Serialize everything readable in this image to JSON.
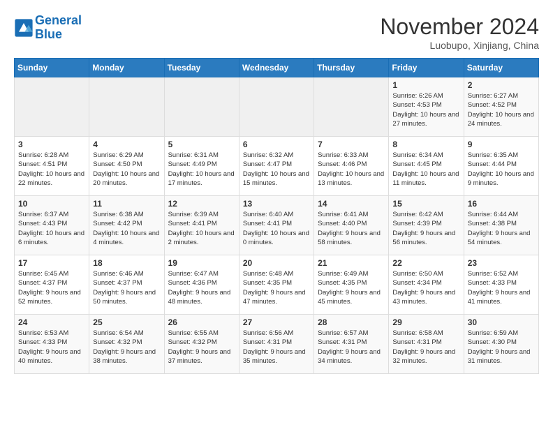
{
  "header": {
    "logo_line1": "General",
    "logo_line2": "Blue",
    "month": "November 2024",
    "location": "Luobupo, Xinjiang, China"
  },
  "days_of_week": [
    "Sunday",
    "Monday",
    "Tuesday",
    "Wednesday",
    "Thursday",
    "Friday",
    "Saturday"
  ],
  "weeks": [
    [
      {
        "day": "",
        "content": ""
      },
      {
        "day": "",
        "content": ""
      },
      {
        "day": "",
        "content": ""
      },
      {
        "day": "",
        "content": ""
      },
      {
        "day": "",
        "content": ""
      },
      {
        "day": "1",
        "content": "Sunrise: 6:26 AM\nSunset: 4:53 PM\nDaylight: 10 hours and 27 minutes."
      },
      {
        "day": "2",
        "content": "Sunrise: 6:27 AM\nSunset: 4:52 PM\nDaylight: 10 hours and 24 minutes."
      }
    ],
    [
      {
        "day": "3",
        "content": "Sunrise: 6:28 AM\nSunset: 4:51 PM\nDaylight: 10 hours and 22 minutes."
      },
      {
        "day": "4",
        "content": "Sunrise: 6:29 AM\nSunset: 4:50 PM\nDaylight: 10 hours and 20 minutes."
      },
      {
        "day": "5",
        "content": "Sunrise: 6:31 AM\nSunset: 4:49 PM\nDaylight: 10 hours and 17 minutes."
      },
      {
        "day": "6",
        "content": "Sunrise: 6:32 AM\nSunset: 4:47 PM\nDaylight: 10 hours and 15 minutes."
      },
      {
        "day": "7",
        "content": "Sunrise: 6:33 AM\nSunset: 4:46 PM\nDaylight: 10 hours and 13 minutes."
      },
      {
        "day": "8",
        "content": "Sunrise: 6:34 AM\nSunset: 4:45 PM\nDaylight: 10 hours and 11 minutes."
      },
      {
        "day": "9",
        "content": "Sunrise: 6:35 AM\nSunset: 4:44 PM\nDaylight: 10 hours and 9 minutes."
      }
    ],
    [
      {
        "day": "10",
        "content": "Sunrise: 6:37 AM\nSunset: 4:43 PM\nDaylight: 10 hours and 6 minutes."
      },
      {
        "day": "11",
        "content": "Sunrise: 6:38 AM\nSunset: 4:42 PM\nDaylight: 10 hours and 4 minutes."
      },
      {
        "day": "12",
        "content": "Sunrise: 6:39 AM\nSunset: 4:41 PM\nDaylight: 10 hours and 2 minutes."
      },
      {
        "day": "13",
        "content": "Sunrise: 6:40 AM\nSunset: 4:41 PM\nDaylight: 10 hours and 0 minutes."
      },
      {
        "day": "14",
        "content": "Sunrise: 6:41 AM\nSunset: 4:40 PM\nDaylight: 9 hours and 58 minutes."
      },
      {
        "day": "15",
        "content": "Sunrise: 6:42 AM\nSunset: 4:39 PM\nDaylight: 9 hours and 56 minutes."
      },
      {
        "day": "16",
        "content": "Sunrise: 6:44 AM\nSunset: 4:38 PM\nDaylight: 9 hours and 54 minutes."
      }
    ],
    [
      {
        "day": "17",
        "content": "Sunrise: 6:45 AM\nSunset: 4:37 PM\nDaylight: 9 hours and 52 minutes."
      },
      {
        "day": "18",
        "content": "Sunrise: 6:46 AM\nSunset: 4:37 PM\nDaylight: 9 hours and 50 minutes."
      },
      {
        "day": "19",
        "content": "Sunrise: 6:47 AM\nSunset: 4:36 PM\nDaylight: 9 hours and 48 minutes."
      },
      {
        "day": "20",
        "content": "Sunrise: 6:48 AM\nSunset: 4:35 PM\nDaylight: 9 hours and 47 minutes."
      },
      {
        "day": "21",
        "content": "Sunrise: 6:49 AM\nSunset: 4:35 PM\nDaylight: 9 hours and 45 minutes."
      },
      {
        "day": "22",
        "content": "Sunrise: 6:50 AM\nSunset: 4:34 PM\nDaylight: 9 hours and 43 minutes."
      },
      {
        "day": "23",
        "content": "Sunrise: 6:52 AM\nSunset: 4:33 PM\nDaylight: 9 hours and 41 minutes."
      }
    ],
    [
      {
        "day": "24",
        "content": "Sunrise: 6:53 AM\nSunset: 4:33 PM\nDaylight: 9 hours and 40 minutes."
      },
      {
        "day": "25",
        "content": "Sunrise: 6:54 AM\nSunset: 4:32 PM\nDaylight: 9 hours and 38 minutes."
      },
      {
        "day": "26",
        "content": "Sunrise: 6:55 AM\nSunset: 4:32 PM\nDaylight: 9 hours and 37 minutes."
      },
      {
        "day": "27",
        "content": "Sunrise: 6:56 AM\nSunset: 4:31 PM\nDaylight: 9 hours and 35 minutes."
      },
      {
        "day": "28",
        "content": "Sunrise: 6:57 AM\nSunset: 4:31 PM\nDaylight: 9 hours and 34 minutes."
      },
      {
        "day": "29",
        "content": "Sunrise: 6:58 AM\nSunset: 4:31 PM\nDaylight: 9 hours and 32 minutes."
      },
      {
        "day": "30",
        "content": "Sunrise: 6:59 AM\nSunset: 4:30 PM\nDaylight: 9 hours and 31 minutes."
      }
    ]
  ]
}
